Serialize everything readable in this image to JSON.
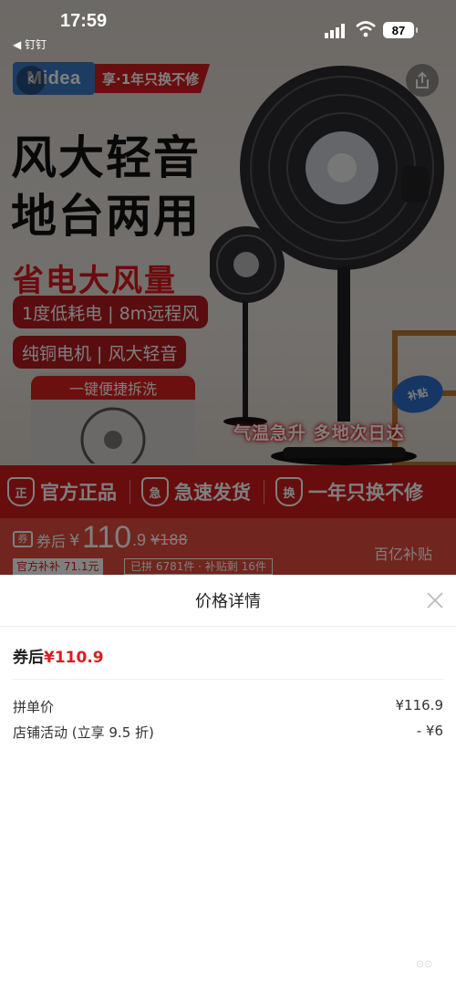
{
  "status_bar": {
    "time": "17:59",
    "back_app": "◀ 钉钉",
    "battery": "87"
  },
  "product": {
    "brand": "Midea",
    "brand_tag": "享·1年只换不修",
    "headline_line1": "风大轻音",
    "headline_line2": "地台两用",
    "subheadline": "省电大风量",
    "feature_pill_1": "1度低耗电 | 8m远程风",
    "feature_pill_2": "纯铜电机 | 风大轻音",
    "wash_label": "一键便捷拆洗",
    "promo_banner": "气温急升 多地次日达",
    "guarantees": [
      {
        "icon": "正",
        "label": "官方正品"
      },
      {
        "icon": "急",
        "label": "急速发货"
      },
      {
        "icon": "换",
        "label": "一年只换不修"
      }
    ],
    "price_label": "券后",
    "price_currency": "¥",
    "price_integer": "110",
    "price_decimal": ".9",
    "original_price": "¥188",
    "subsidy_label": "百亿补贴",
    "chip_official": "官方补补 71.1元",
    "chip_sold": "已拼 6781件 · 补贴剩 16件"
  },
  "sheet": {
    "title": "价格详情",
    "final_label": "券后",
    "final_price": "¥110.9",
    "rows": [
      {
        "label": "拼单价",
        "value": "¥116.9"
      },
      {
        "label": "店铺活动 (立享 9.5 折)",
        "value": "- ¥6"
      }
    ]
  },
  "colors": {
    "accent_red": "#d81e1e",
    "overlay": "rgba(0,0,0,0.5)"
  }
}
